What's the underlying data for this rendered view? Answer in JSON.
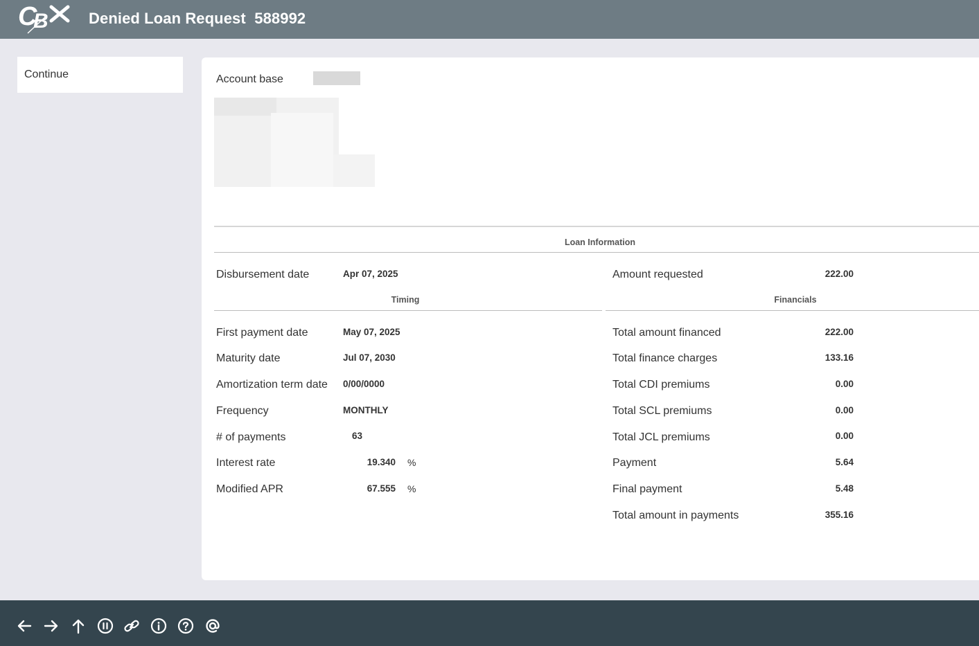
{
  "header": {
    "title": "Denied Loan Request  588992",
    "logo_text": "CBX"
  },
  "sidebar": {
    "continue_label": "Continue"
  },
  "account": {
    "label": "Account base"
  },
  "loan_info": {
    "heading": "Loan Information",
    "disbursement_label": "Disbursement date",
    "disbursement_value": "Apr 07, 2025",
    "amount_requested_label": "Amount requested",
    "amount_requested_value": "222.00"
  },
  "timing": {
    "heading": "Timing",
    "rows": [
      {
        "label": "First payment date",
        "value": "May 07, 2025"
      },
      {
        "label": "Maturity date",
        "value": "Jul 07, 2030"
      },
      {
        "label": "Amortization term date",
        "value": "0/00/0000"
      },
      {
        "label": "Frequency",
        "value": "MONTHLY"
      },
      {
        "label": "# of payments",
        "value": "63"
      },
      {
        "label": "Interest rate",
        "value": "19.340",
        "unit": "%"
      },
      {
        "label": "Modified APR",
        "value": "67.555",
        "unit": "%"
      }
    ]
  },
  "financials": {
    "heading": "Financials",
    "rows": [
      {
        "label": "Total amount financed",
        "value": "222.00"
      },
      {
        "label": "Total finance charges",
        "value": "133.16"
      },
      {
        "label": "Total CDI premiums",
        "value": "0.00"
      },
      {
        "label": "Total SCL premiums",
        "value": "0.00"
      },
      {
        "label": "Total JCL premiums",
        "value": "0.00"
      },
      {
        "label": "Payment",
        "value": "5.64"
      },
      {
        "label": "Final payment",
        "value": "5.48"
      },
      {
        "label": "Total amount in payments",
        "value": "355.16"
      }
    ]
  },
  "footer": {
    "icons": [
      "arrow-left-icon",
      "arrow-right-icon",
      "arrow-up-icon",
      "pause-icon",
      "link-icon",
      "info-icon",
      "help-icon",
      "at-icon"
    ]
  },
  "colors": {
    "header_bg": "#6e7c84",
    "footer_bg": "#34454e",
    "page_bg": "#e8e8ee"
  }
}
